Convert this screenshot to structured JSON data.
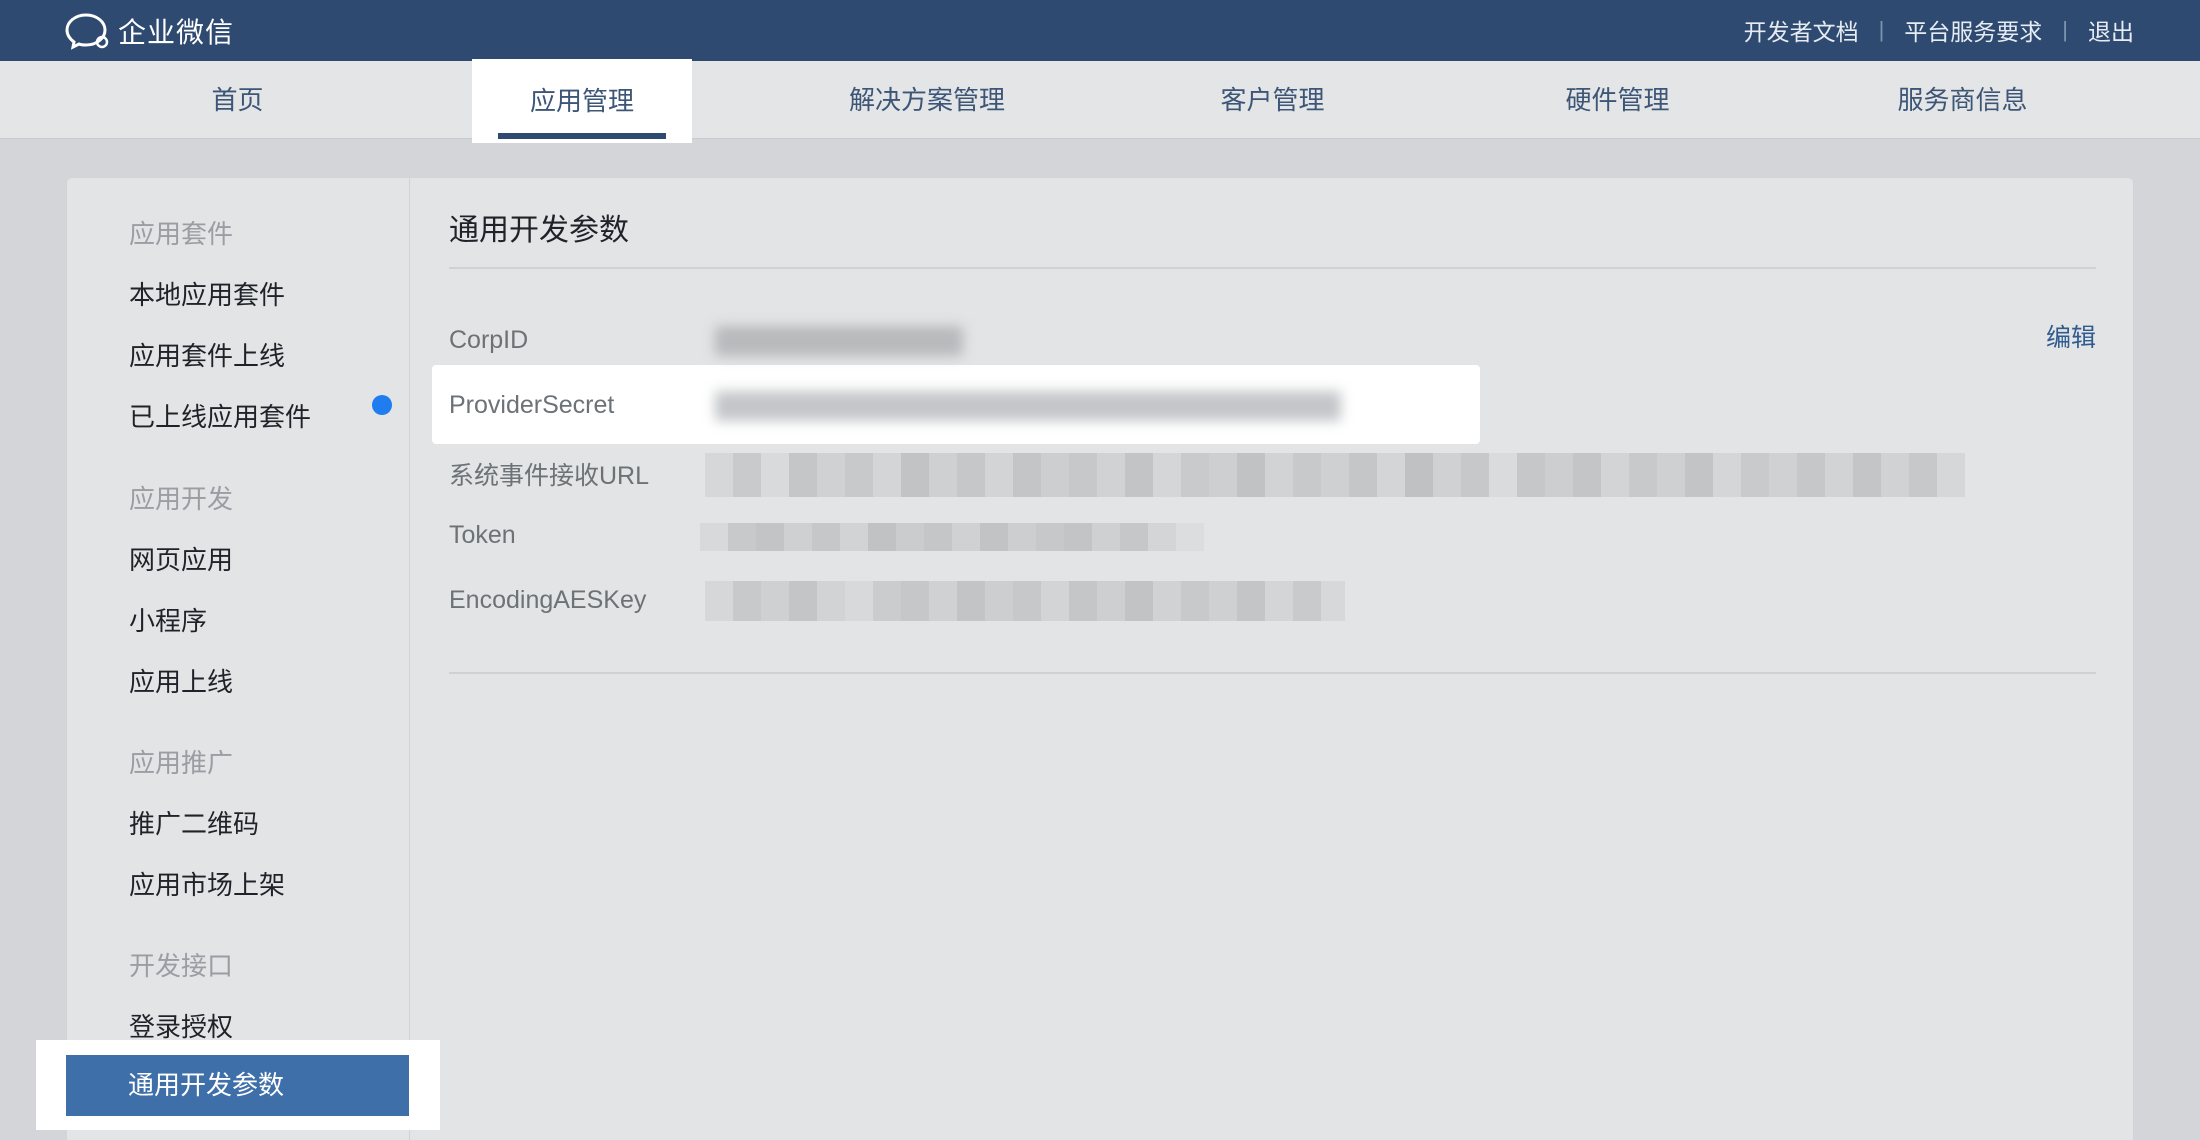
{
  "header": {
    "app_name": "企业微信",
    "links": [
      "开发者文档",
      "平台服务要求",
      "退出"
    ]
  },
  "nav": {
    "tabs": [
      "首页",
      "应用管理",
      "解决方案管理",
      "客户管理",
      "硬件管理",
      "服务商信息"
    ],
    "active": "应用管理"
  },
  "sidebar": {
    "groups": [
      {
        "title": "应用套件",
        "items": [
          "本地应用套件",
          "应用套件上线",
          "已上线应用套件"
        ]
      },
      {
        "title": "应用开发",
        "items": [
          "网页应用",
          "小程序",
          "应用上线"
        ]
      },
      {
        "title": "应用推广",
        "items": [
          "推广二维码",
          "应用市场上架"
        ]
      },
      {
        "title": "开发接口",
        "items": [
          "登录授权",
          "通用开发参数"
        ]
      }
    ],
    "active_item": "通用开发参数"
  },
  "main": {
    "title": "通用开发参数",
    "edit_label": "编辑",
    "fields": [
      {
        "label": "CorpID"
      },
      {
        "label": "ProviderSecret"
      },
      {
        "label": "系统事件接收URL"
      },
      {
        "label": "Token"
      },
      {
        "label": "EncodingAESKey"
      }
    ]
  },
  "colors": {
    "topbar": "#2e4a70",
    "accent": "#3f6fa9",
    "link": "#2f5b8f",
    "notification_dot": "#1f7df0"
  }
}
